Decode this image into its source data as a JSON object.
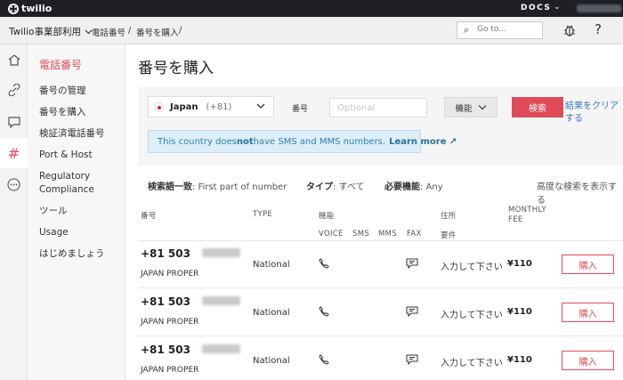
{
  "topbar": {
    "brand": "twilio",
    "docs_label": "DOCS"
  },
  "subbar": {
    "project": "Twilio事業部利用",
    "breadcrumbs": [
      "電話番号",
      "/",
      "番号を購入",
      "/"
    ],
    "search_placeholder": "Go to..."
  },
  "rail": {
    "icons": [
      "home-icon",
      "link-icon",
      "chat-icon",
      "hash-icon",
      "more-icon"
    ],
    "active_glyph": "#"
  },
  "sidebar": {
    "title": "電話番号",
    "items": [
      "番号の管理",
      "番号を購入",
      "検証済電話番号",
      "Port & Host",
      "Regulatory",
      "Compliance",
      "ツール",
      "Usage",
      "はじめましょう"
    ]
  },
  "page_title": "番号を購入",
  "search_form": {
    "country_name": "Japan",
    "country_code": "(+81)",
    "number_label": "番号",
    "number_placeholder": "Optional",
    "features_label": "機能",
    "search_button": "検索",
    "clear_link": "結果をクリアする"
  },
  "notice": {
    "pre": "This country does ",
    "emph": "not",
    "post": " have SMS and MMS numbers.",
    "link": "Learn more ↗"
  },
  "filters": {
    "match_key": "検索語一致",
    "match_val": ": First part of number",
    "type_key": "タイプ",
    "type_val": ": すべて",
    "cap_key": "必要機能",
    "cap_val": ": Any",
    "advanced": "高度な検索を表示する"
  },
  "table": {
    "headers": {
      "number": "番号",
      "type": "TYPE",
      "capabilities": "機能",
      "voice": "VOICE",
      "sms": "SMS",
      "mms": "MMS",
      "fax": "FAX",
      "address": "住所",
      "requirements": "要件",
      "fee_line1": "MONTHLY",
      "fee_line2": "FEE"
    },
    "rows": [
      {
        "number": "+81 503",
        "region": "JAPAN PROPER",
        "type": "National",
        "address": "入力して下さい",
        "price": "¥110",
        "buy": "購入"
      },
      {
        "number": "+81 503",
        "region": "JAPAN PROPER",
        "type": "National",
        "address": "入力して下さい",
        "price": "¥110",
        "buy": "購入"
      },
      {
        "number": "+81 503",
        "region": "JAPAN PROPER",
        "type": "National",
        "address": "入力して下さい",
        "price": "¥110",
        "buy": "購入"
      }
    ]
  },
  "colors": {
    "accent": "#e04b5a",
    "topbar": "#1f2025",
    "link": "#3d74b8",
    "info_bg": "#dceef7"
  }
}
